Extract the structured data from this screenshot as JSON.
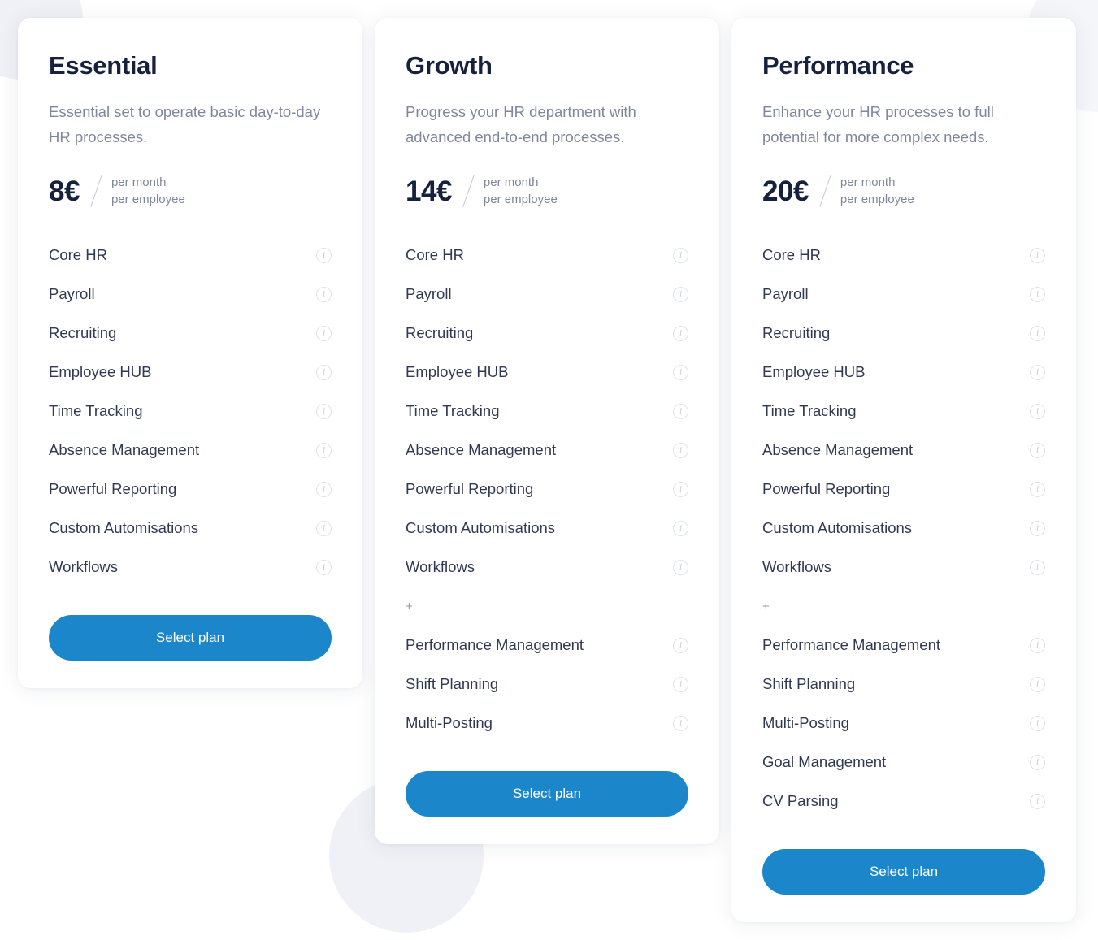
{
  "page": {
    "background_color": "#ffffff",
    "accent_color": "#1b86c9",
    "heading_color": "#16213e",
    "muted_color": "#7e879c"
  },
  "plans": [
    {
      "id": "essential",
      "name": "Essential",
      "description": "Essential set to operate basic day-to-day HR processes.",
      "price": "8€",
      "unit_line_1": "per month",
      "unit_line_2": "per employee",
      "cta_label": "Select plan",
      "plus_divider": null,
      "features": [
        "Core HR",
        "Payroll",
        "Recruiting",
        "Employee HUB",
        "Time Tracking",
        "Absence Management",
        "Powerful Reporting",
        "Custom Automisations",
        "Workflows"
      ],
      "extra_features": []
    },
    {
      "id": "growth",
      "name": "Growth",
      "description": "Progress your HR department with advanced end-to-end processes.",
      "price": "14€",
      "unit_line_1": "per month",
      "unit_line_2": "per employee",
      "cta_label": "Select plan",
      "plus_divider": "+",
      "features": [
        "Core HR",
        "Payroll",
        "Recruiting",
        "Employee HUB",
        "Time Tracking",
        "Absence Management",
        "Powerful Reporting",
        "Custom Automisations",
        "Workflows"
      ],
      "extra_features": [
        "Performance Management",
        "Shift Planning",
        "Multi-Posting"
      ]
    },
    {
      "id": "performance",
      "name": "Performance",
      "description": "Enhance your HR processes to full potential for more complex needs.",
      "price": "20€",
      "unit_line_1": "per month",
      "unit_line_2": "per employee",
      "cta_label": "Select plan",
      "plus_divider": "+",
      "features": [
        "Core HR",
        "Payroll",
        "Recruiting",
        "Employee HUB",
        "Time Tracking",
        "Absence Management",
        "Powerful Reporting",
        "Custom Automisations",
        "Workflows"
      ],
      "extra_features": [
        "Performance Management",
        "Shift Planning",
        "Multi-Posting",
        "Goal Management",
        "CV Parsing"
      ]
    }
  ],
  "icons": {
    "info": "i",
    "info_name": "info-icon"
  }
}
